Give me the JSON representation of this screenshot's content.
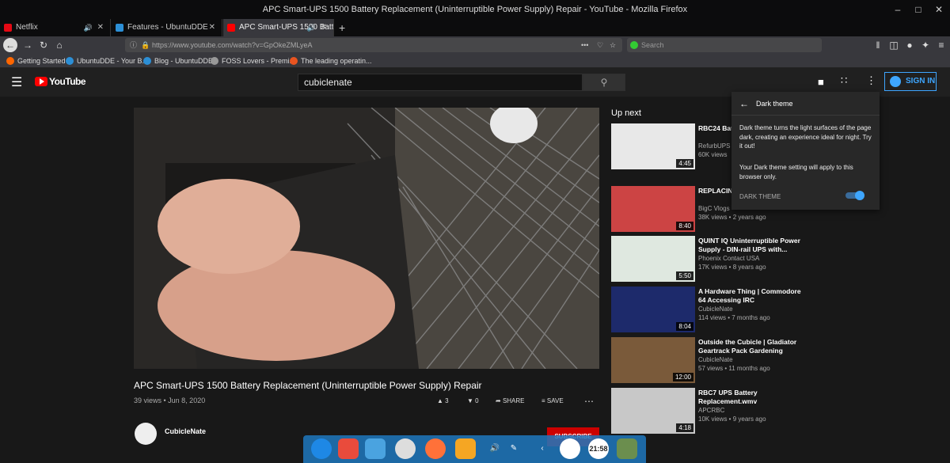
{
  "window": {
    "title": "APC Smart-UPS 1500 Battery Replacement (Uninterruptible Power Supply) Repair - YouTube - Mozilla Firefox"
  },
  "tabs": [
    {
      "label": "Netflix"
    },
    {
      "label": "Features - UbuntuDDE"
    },
    {
      "label": "APC Smart-UPS 1500 Batt"
    }
  ],
  "nav": {
    "url": "https://www.youtube.com/watch?v=GpOkeZMLyeA",
    "search_placeholder": "Search"
  },
  "bookmarks": [
    "Getting Started",
    "UbuntuDDE - Your B...",
    "Blog - UbuntuDDE",
    "FOSS Lovers - Premi...",
    "The leading operatin..."
  ],
  "youtube": {
    "logo": "YouTube",
    "search_value": "cubiclenate",
    "signin": "SIGN IN",
    "video": {
      "title": "APC Smart-UPS 1500 Battery Replacement (Uninterruptible Power Supply) Repair",
      "meta": "39 views • Jun 8, 2020",
      "likes": "3",
      "dislikes": "0",
      "share": "SHARE",
      "save": "SAVE",
      "channel": "CubicleNate",
      "subscribe": "SUBSCRIBE"
    },
    "upnext_label": "Up next",
    "related": [
      {
        "title": "RBC24 Bat APC Smart",
        "channel": "RefurbUPS",
        "views": "60K views",
        "duration": "4:45",
        "thumb": "#e8e8e8"
      },
      {
        "title": "REPLACIN 1000/1300",
        "channel": "BigC Vlogs",
        "views": "38K views • 2 years ago",
        "duration": "8:40",
        "thumb": "#c44"
      },
      {
        "title": "QUINT IQ Uninterruptible Power Supply - DIN-rail UPS with...",
        "channel": "Phoenix Contact USA",
        "views": "17K views • 8 years ago",
        "duration": "5:50",
        "thumb": "#dfe8e0"
      },
      {
        "title": "A Hardware Thing | Commodore 64 Accessing IRC",
        "channel": "CubicleNate",
        "views": "114 views • 7 months ago",
        "duration": "8:04",
        "thumb": "#1d2a6b"
      },
      {
        "title": "Outside the Cubicle | Gladiator Geartrack Pack Gardening",
        "channel": "CubicleNate",
        "views": "57 views • 11 months ago",
        "duration": "12:00",
        "thumb": "#7a5a3a"
      },
      {
        "title": "RBC7 UPS Battery Replacement.wmv",
        "channel": "APCRBC",
        "views": "10K views • 9 years ago",
        "duration": "4:18",
        "thumb": "#c8c8c8"
      }
    ],
    "popup": {
      "title": "Dark theme",
      "para1": "Dark theme turns the light surfaces of the page dark, creating an experience ideal for night. Try it out!",
      "para2": "Your Dark theme setting will apply to this browser only.",
      "toggle_label": "DARK THEME",
      "toggle_on": true
    }
  },
  "dock": {
    "clock": "21:58"
  }
}
